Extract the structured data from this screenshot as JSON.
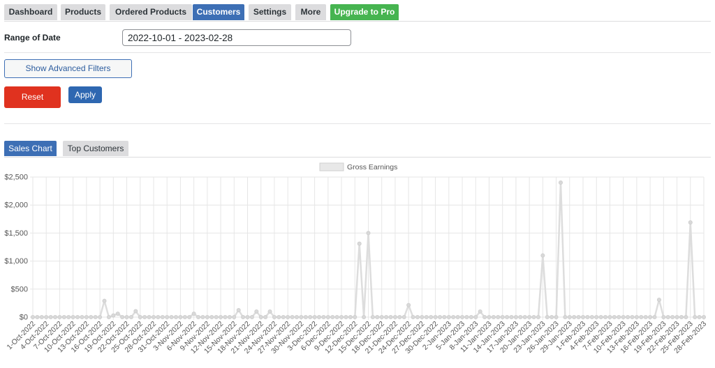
{
  "nav": {
    "tabs": [
      {
        "label": "Dashboard"
      },
      {
        "label": "Products"
      },
      {
        "label": "Ordered Products"
      },
      {
        "label": "Customers"
      },
      {
        "label": "Settings"
      },
      {
        "label": "More"
      },
      {
        "label": "Upgrade to Pro"
      }
    ],
    "active": "Customers"
  },
  "filters": {
    "date_label": "Range of Date",
    "date_value": "2022-10-01 - 2023-02-28",
    "advanced_button": "Show Advanced Filters",
    "reset_button": "Reset",
    "apply_button": "Apply"
  },
  "colors": {
    "active_tab": "#3d6fb5",
    "pro_tab": "#46b450",
    "reset": "#e0321f",
    "series": "#dddddd"
  },
  "chart_tabs": [
    {
      "label": "Sales Chart"
    },
    {
      "label": "Top Customers"
    }
  ],
  "chart_data": {
    "type": "line",
    "legend": [
      "Gross Earnings"
    ],
    "legend_position": "top",
    "grid": true,
    "ylim": [
      0,
      2500
    ],
    "y_ticks": [
      "$0",
      "$500",
      "$1,000",
      "$1,500",
      "$2,000",
      "$2,500"
    ],
    "x_start": "2022-10-01",
    "x_end": "2023-02-28",
    "x_labels": [
      "1-Oct-2022",
      "4-Oct-2022",
      "7-Oct-2022",
      "10-Oct-2022",
      "13-Oct-2022",
      "16-Oct-2022",
      "19-Oct-2022",
      "22-Oct-2022",
      "25-Oct-2022",
      "28-Oct-2022",
      "31-Oct-2022",
      "3-Nov-2022",
      "6-Nov-2022",
      "9-Nov-2022",
      "12-Nov-2022",
      "15-Nov-2022",
      "18-Nov-2022",
      "21-Nov-2022",
      "24-Nov-2022",
      "27-Nov-2022",
      "30-Nov-2022",
      "3-Dec-2022",
      "6-Dec-2022",
      "9-Dec-2022",
      "12-Dec-2022",
      "15-Dec-2022",
      "18-Dec-2022",
      "21-Dec-2022",
      "24-Dec-2022",
      "27-Dec-2022",
      "30-Dec-2022",
      "2-Jan-2023",
      "5-Jan-2023",
      "8-Jan-2023",
      "11-Jan-2023",
      "14-Jan-2023",
      "17-Jan-2023",
      "20-Jan-2023",
      "23-Jan-2023",
      "26-Jan-2023",
      "29-Jan-2023",
      "1-Feb-2023",
      "4-Feb-2023",
      "7-Feb-2023",
      "10-Feb-2023",
      "13-Feb-2023",
      "16-Feb-2023",
      "19-Feb-2023",
      "22-Feb-2023",
      "25-Feb-2023",
      "28-Feb-2023"
    ],
    "series": [
      {
        "name": "Gross Earnings",
        "points": [
          {
            "x": "2022-10-17",
            "y": 290
          },
          {
            "x": "2022-10-19",
            "y": 30
          },
          {
            "x": "2022-10-20",
            "y": 60
          },
          {
            "x": "2022-10-24",
            "y": 105
          },
          {
            "x": "2022-11-06",
            "y": 60
          },
          {
            "x": "2022-11-16",
            "y": 125
          },
          {
            "x": "2022-11-20",
            "y": 100
          },
          {
            "x": "2022-11-23",
            "y": 100
          },
          {
            "x": "2022-12-13",
            "y": 1310
          },
          {
            "x": "2022-12-15",
            "y": 1500
          },
          {
            "x": "2022-12-24",
            "y": 215
          },
          {
            "x": "2023-01-09",
            "y": 100
          },
          {
            "x": "2023-01-23",
            "y": 1100
          },
          {
            "x": "2023-01-27",
            "y": 2400
          },
          {
            "x": "2023-02-18",
            "y": 310
          },
          {
            "x": "2023-02-25",
            "y": 1690
          }
        ],
        "default": 0
      }
    ]
  }
}
